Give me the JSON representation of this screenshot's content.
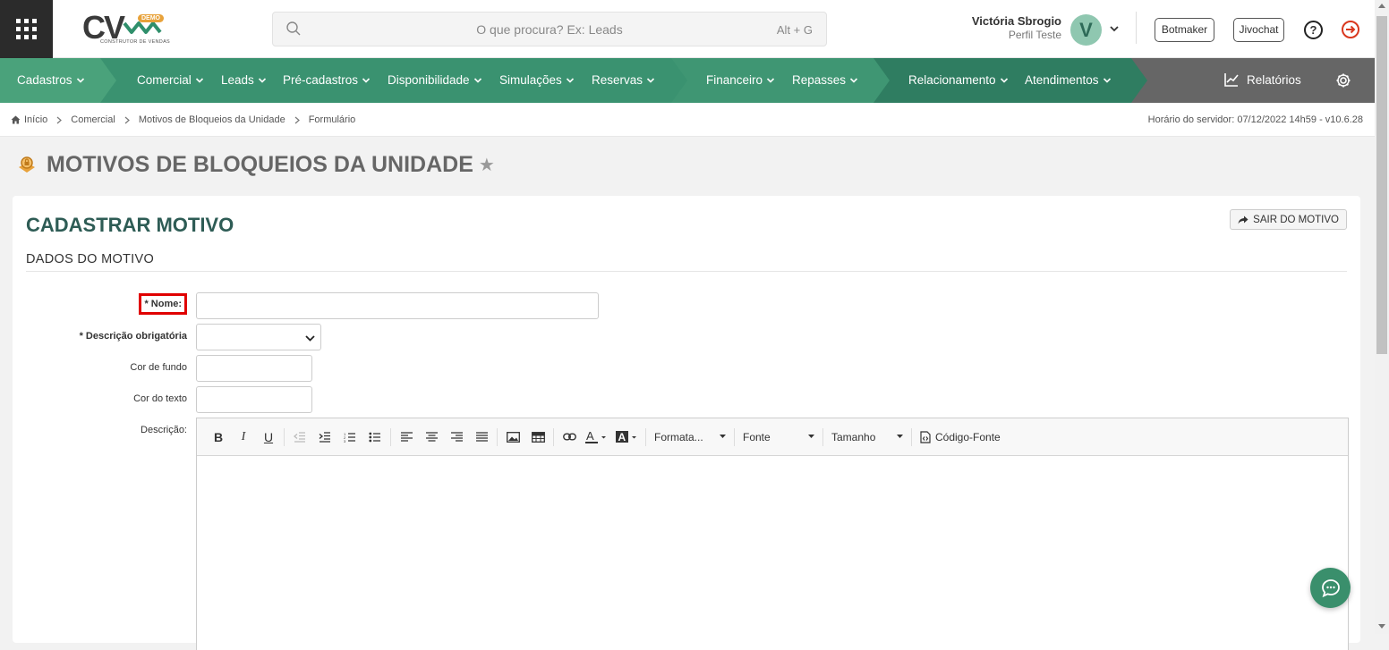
{
  "header": {
    "logo_text": "CV",
    "logo_badge": "DEMO",
    "logo_subtitle": "CONSTRUTOR DE VENDAS",
    "search_placeholder": "O que procura? Ex: Leads",
    "search_shortcut": "Alt + G",
    "user_name": "Victória Sbrogio",
    "user_profile": "Perfil Teste",
    "avatar_letter": "V",
    "botmaker_label": "Botmaker",
    "jivochat_label": "Jivochat",
    "help_label": "?"
  },
  "nav": {
    "items": [
      {
        "label": "Cadastros"
      },
      {
        "label": "Comercial"
      },
      {
        "label": "Leads"
      },
      {
        "label": "Pré-cadastros"
      },
      {
        "label": "Disponibilidade"
      },
      {
        "label": "Simulações"
      },
      {
        "label": "Reservas"
      },
      {
        "label": "Financeiro"
      },
      {
        "label": "Repasses"
      },
      {
        "label": "Relacionamento"
      },
      {
        "label": "Atendimentos"
      }
    ],
    "reports_label": "Relatórios",
    "colors": {
      "green_light": "#4aa27b",
      "green_mid": "#3f9673",
      "green_dark": "#2f7d61",
      "gray": "#666666"
    }
  },
  "breadcrumb": {
    "items": [
      "Início",
      "Comercial",
      "Motivos de Bloqueios da Unidade",
      "Formulário"
    ],
    "server_time": "Horário do servidor: 07/12/2022 14h59 - v10.6.28"
  },
  "page": {
    "title": "MOTIVOS DE BLOQUEIOS DA UNIDADE"
  },
  "form": {
    "card_title": "CADASTRAR MOTIVO",
    "exit_label": "SAIR DO MOTIVO",
    "section_title": "DADOS DO MOTIVO",
    "name_label": "* Nome:",
    "name_value": "",
    "required_desc_label": "* Descrição obrigatória",
    "required_desc_value": "",
    "bg_color_label": "Cor de fundo",
    "bg_color_value": "",
    "text_color_label": "Cor do texto",
    "text_color_value": "",
    "description_label": "Descrição:"
  },
  "editor": {
    "format_label": "Formata...",
    "font_label": "Fonte",
    "size_label": "Tamanho",
    "source_label": "Código-Fonte"
  }
}
